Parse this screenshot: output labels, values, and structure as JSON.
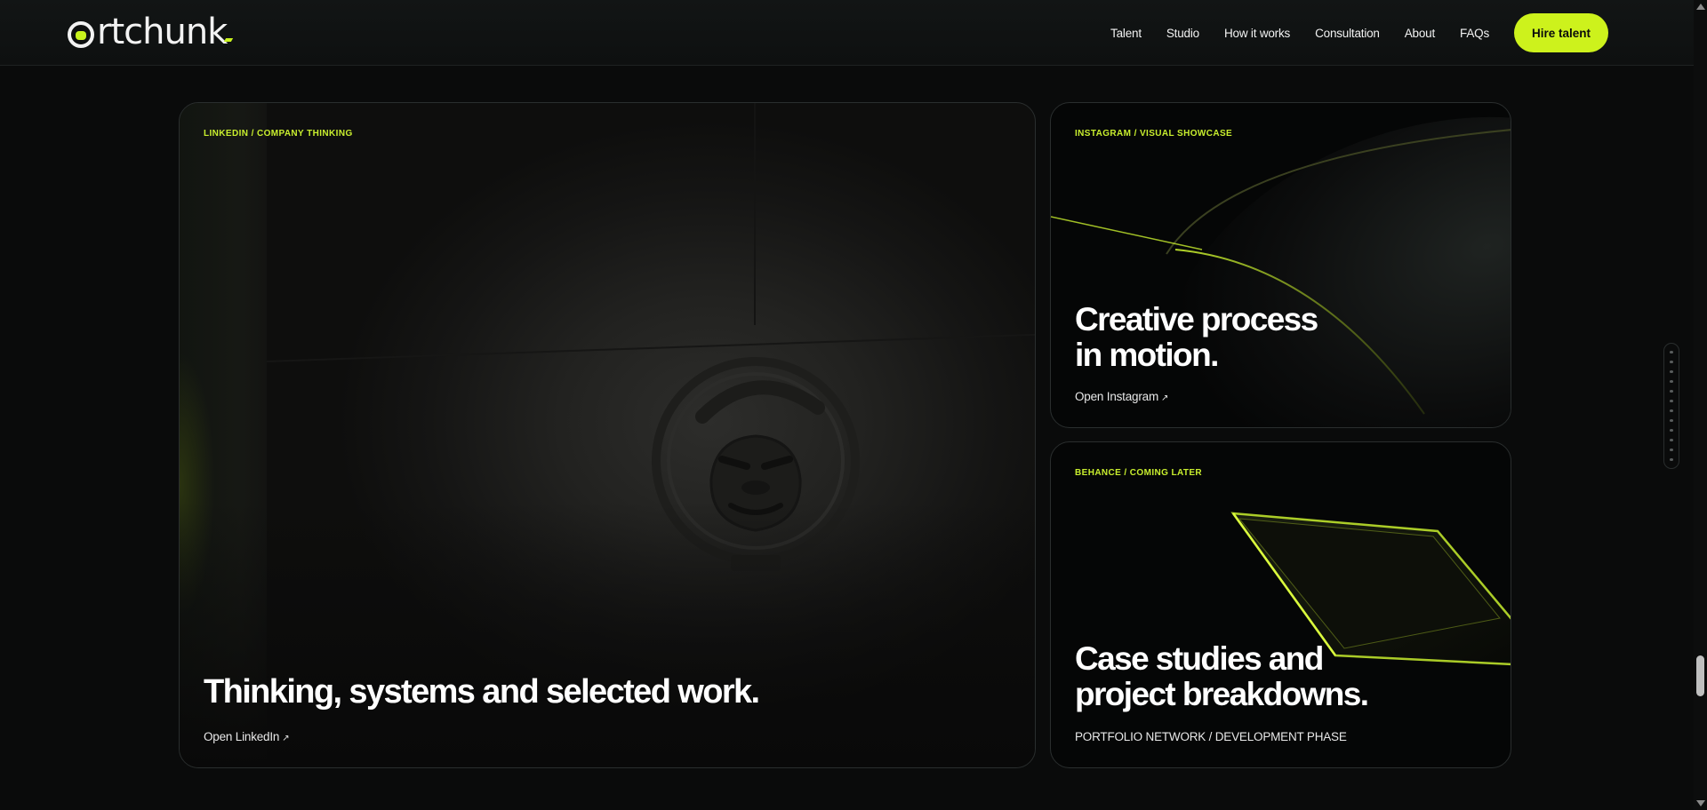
{
  "brand": {
    "name": "artchunk",
    "accent": "#cdf21c"
  },
  "nav": {
    "items": [
      "Talent",
      "Studio",
      "How it works",
      "Consultation",
      "About",
      "FAQs"
    ],
    "cta": "Hire talent"
  },
  "cards": {
    "linkedin": {
      "eyebrow": "LINKEDIN / COMPANY THINKING",
      "title": "Thinking, systems and selected work.",
      "link": "Open LinkedIn",
      "arrow": "↗"
    },
    "instagram": {
      "eyebrow": "INSTAGRAM / VISUAL SHOWCASE",
      "title_line1": "Creative process",
      "title_line2": "in motion.",
      "link": "Open Instagram",
      "arrow": "↗"
    },
    "behance": {
      "eyebrow": "BEHANCE / COMING LATER",
      "title_line1": "Case studies and",
      "title_line2": "project breakdowns.",
      "note": "PORTFOLIO NETWORK / DEVELOPMENT PHASE"
    }
  },
  "icons": [
    "gorilla-logo-icon",
    "scroll-dots-icon",
    "arrow-up-right-icon"
  ]
}
